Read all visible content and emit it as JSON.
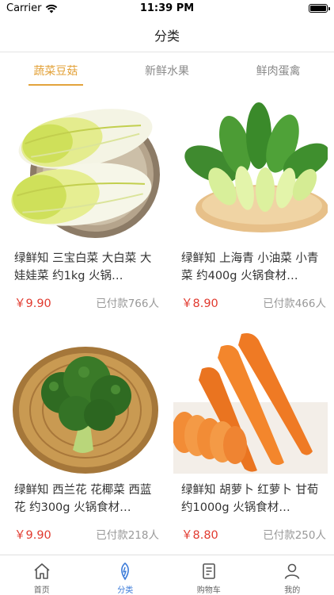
{
  "status_bar": {
    "carrier": "Carrier",
    "time": "11:39 PM"
  },
  "nav": {
    "title": "分类"
  },
  "tabs": [
    {
      "label": "蔬菜豆菇",
      "active": true
    },
    {
      "label": "新鲜水果",
      "active": false
    },
    {
      "label": "鲜肉蛋禽",
      "active": false
    }
  ],
  "products": [
    {
      "name": "绿鲜知 三宝白菜 大白菜 大娃娃菜 约1kg 火锅…",
      "price": "￥9.90",
      "sales": "已付款766人",
      "image_icon": "napa-cabbage-image"
    },
    {
      "name": "绿鲜知 上海青 小油菜 小青菜 约400g 火锅食材…",
      "price": "￥8.90",
      "sales": "已付款466人",
      "image_icon": "bok-choy-image"
    },
    {
      "name": "绿鲜知 西兰花 花椰菜 西蓝花 约300g 火锅食材…",
      "price": "￥9.90",
      "sales": "已付款218人",
      "image_icon": "broccoli-image"
    },
    {
      "name": "绿鲜知 胡萝卜 红萝卜 甘荀 约1000g 火锅食材…",
      "price": "￥8.80",
      "sales": "已付款250人",
      "image_icon": "carrot-image"
    }
  ],
  "tab_bar": [
    {
      "label": "首页",
      "icon": "home-icon",
      "active": false
    },
    {
      "label": "分类",
      "icon": "category-icon",
      "active": true
    },
    {
      "label": "购物车",
      "icon": "cart-icon",
      "active": false
    },
    {
      "label": "我的",
      "icon": "profile-icon",
      "active": false
    }
  ],
  "colors": {
    "accent": "#e3a33c",
    "price": "#e13a2f",
    "tab_active": "#3b7bd9",
    "muted": "#999999"
  }
}
